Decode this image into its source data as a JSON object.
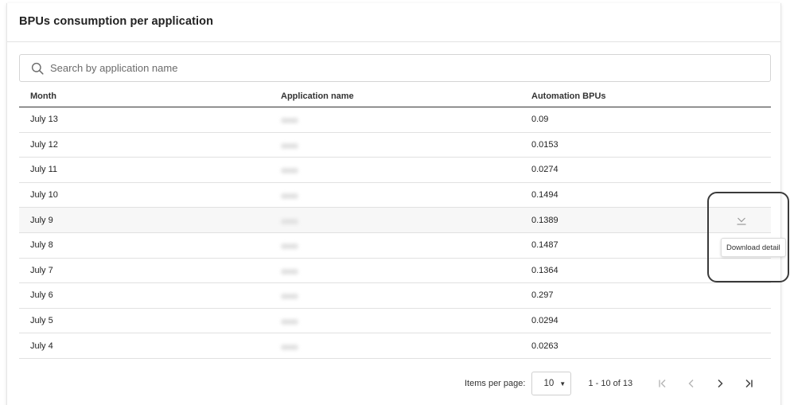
{
  "card": {
    "title": "BPUs consumption per application"
  },
  "search": {
    "placeholder": "Search by application name",
    "value": ""
  },
  "table": {
    "columns": [
      "Month",
      "Application name",
      "Automation BPUs"
    ],
    "rows": [
      {
        "month": "July 13",
        "app": "",
        "bpus": "0.09"
      },
      {
        "month": "July 12",
        "app": "",
        "bpus": "0.0153"
      },
      {
        "month": "July 11",
        "app": "",
        "bpus": "0.0274"
      },
      {
        "month": "July 10",
        "app": "",
        "bpus": "0.1494"
      },
      {
        "month": "July 9",
        "app": "",
        "bpus": "0.1389"
      },
      {
        "month": "July 8",
        "app": "",
        "bpus": "0.1487"
      },
      {
        "month": "July 7",
        "app": "",
        "bpus": "0.1364"
      },
      {
        "month": "July 6",
        "app": "",
        "bpus": "0.297"
      },
      {
        "month": "July 5",
        "app": "",
        "bpus": "0.0294"
      },
      {
        "month": "July 4",
        "app": "",
        "bpus": "0.0263"
      }
    ],
    "hovered_row": 4
  },
  "tooltip": {
    "text": "Download detail"
  },
  "pagination": {
    "items_per_page_label": "Items per page:",
    "items_per_page_value": "10",
    "caret": "▼",
    "range_label": "1 - 10 of 13"
  },
  "icons": {
    "search": "search-icon",
    "download": "download-icon",
    "first_page": "first-page-icon",
    "prev_page": "chevron-left-icon",
    "next_page": "chevron-right-icon",
    "last_page": "last-page-icon"
  },
  "colors": {
    "border": "#d4d4d4",
    "header_rule": "#333333",
    "row_hover": "#f7f7f7",
    "highlight": "#3a3a3a"
  }
}
